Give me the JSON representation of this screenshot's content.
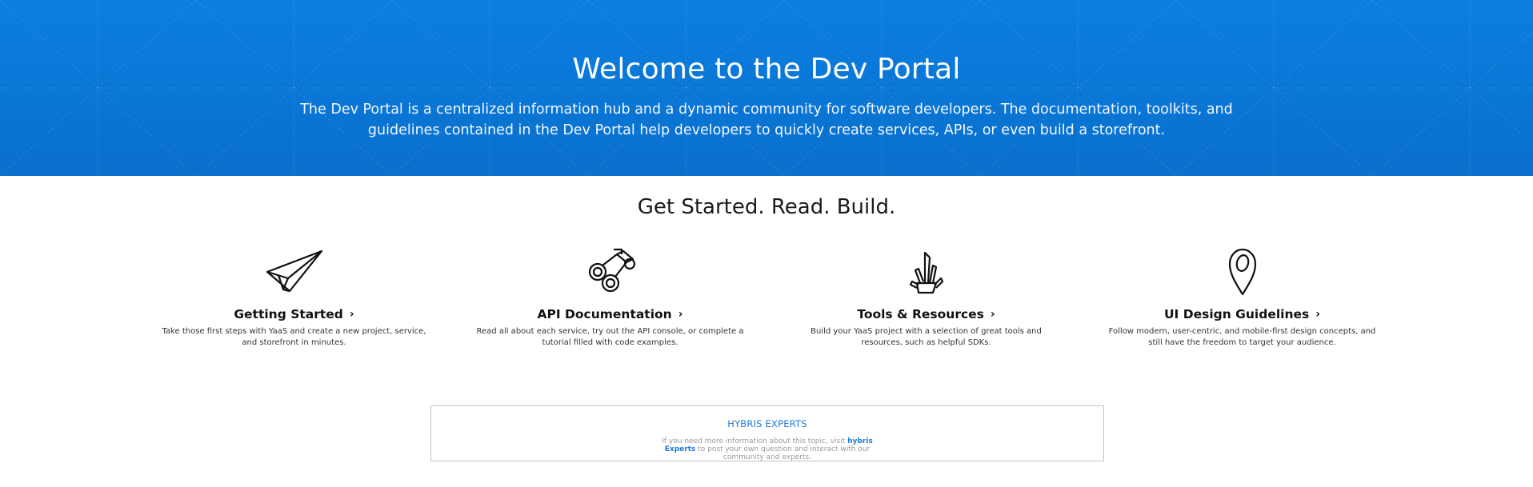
{
  "hero": {
    "title": "Welcome to the Dev Portal",
    "description": "The Dev Portal is a centralized information hub and a dynamic community for software developers. The documentation, toolkits, and guidelines contained in the Dev Portal help developers to quickly create services, APIs, or even build a storefront.",
    "background_color": "#0a77d8"
  },
  "section": {
    "title": "Get Started. Read. Build."
  },
  "features": [
    {
      "icon": "paper-plane-icon",
      "title": "Getting Started",
      "description": "Take those first steps with YaaS and create a new project, service, and storefront in minutes."
    },
    {
      "icon": "binoculars-icon",
      "title": "API Documentation",
      "description": "Read all about each service, try out the API console, or complete a tutorial filled with code examples."
    },
    {
      "icon": "swiss-army-knife-icon",
      "title": "Tools & Resources",
      "description": "Build your YaaS project with a selection of great tools and resources, such as helpful SDKs."
    },
    {
      "icon": "map-pin-icon",
      "title": "UI Design Guidelines",
      "description": "Follow modern, user-centric, and mobile-first design concepts, and still have the freedom to target your audience."
    }
  ],
  "experts": {
    "title": "HYBRIS EXPERTS",
    "text_before": "If you need more information about this topic, visit",
    "link_label": "hybris Experts",
    "text_after": "to post your own question and interact with our community and experts.",
    "accent_color": "#1a7bd6"
  }
}
